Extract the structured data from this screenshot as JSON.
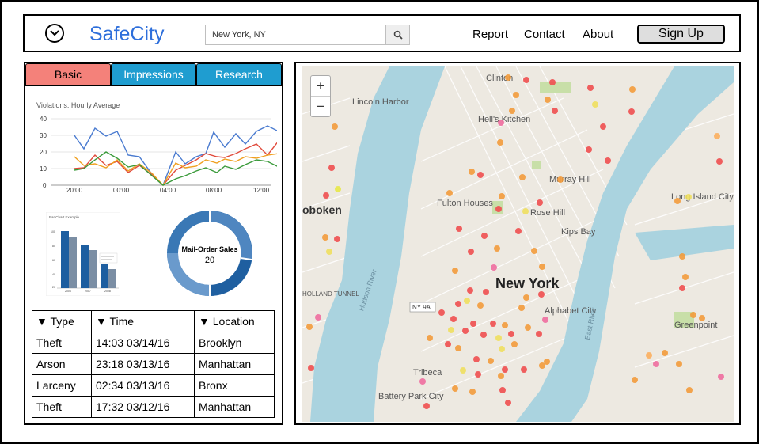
{
  "header": {
    "logo": "SafeCity",
    "search": {
      "value": "New York, NY"
    },
    "nav": [
      "Report",
      "Contact",
      "About"
    ],
    "signup_label": "Sign Up"
  },
  "tabs": [
    "Basic",
    "Impressions",
    "Research"
  ],
  "line_chart": {
    "title": "Violations: Hourly Average",
    "yticks": [
      "40",
      "30",
      "20",
      "10",
      "0"
    ],
    "xticks": [
      "20:00",
      "00:00",
      "04:00",
      "08:00",
      "12:00"
    ]
  },
  "bar_chart": {
    "title": "Bar Chart Example",
    "xticks": [
      "2006",
      "2007",
      "2008"
    ]
  },
  "donut": {
    "label": "Mail-Order Sales",
    "value": "20"
  },
  "table": {
    "headers": [
      "Type",
      "Time",
      "Location"
    ],
    "rows": [
      [
        "Theft",
        "14:03 03/14/16",
        "Brooklyn"
      ],
      [
        "Arson",
        "23:18 03/13/16",
        "Manhattan"
      ],
      [
        "Larceny",
        "02:34 03/13/16",
        "Bronx"
      ],
      [
        "Theft",
        "17:32 03/12/16",
        "Manhattan"
      ]
    ]
  },
  "map": {
    "zoom_in": "+",
    "zoom_out": "−",
    "labels": {
      "clinton": "Clinton",
      "lincoln_harbor": "Lincoln Harbor",
      "hells_kitchen": "Hell's Kitchen",
      "hoboken": "oboken",
      "fulton_houses": "Fulton Houses",
      "rose_hill": "Rose Hill",
      "murray_hill": "Murray Hill",
      "kips_bay": "Kips Bay",
      "long_island_city": "Long Island City",
      "new_york": "New York",
      "alphabet_city": "Alphabet City",
      "greenpoint": "Greenpoint",
      "tribeca": "Tribeca",
      "battery_park_city": "Battery Park City",
      "holland_tunnel": "HOLLAND TUNNEL",
      "hudson_river": "Hudson River",
      "east_river": "East River",
      "ny9a": "NY 9A"
    }
  },
  "colors": {
    "logo": "#2e6fdb",
    "basic_tab": "#f4817a",
    "other_tabs": "#1f9dd0",
    "water": "#aad3df",
    "donut": "#3a78b5"
  },
  "icons": {
    "menu": "chevron-down-circle-icon",
    "search": "search-icon"
  }
}
